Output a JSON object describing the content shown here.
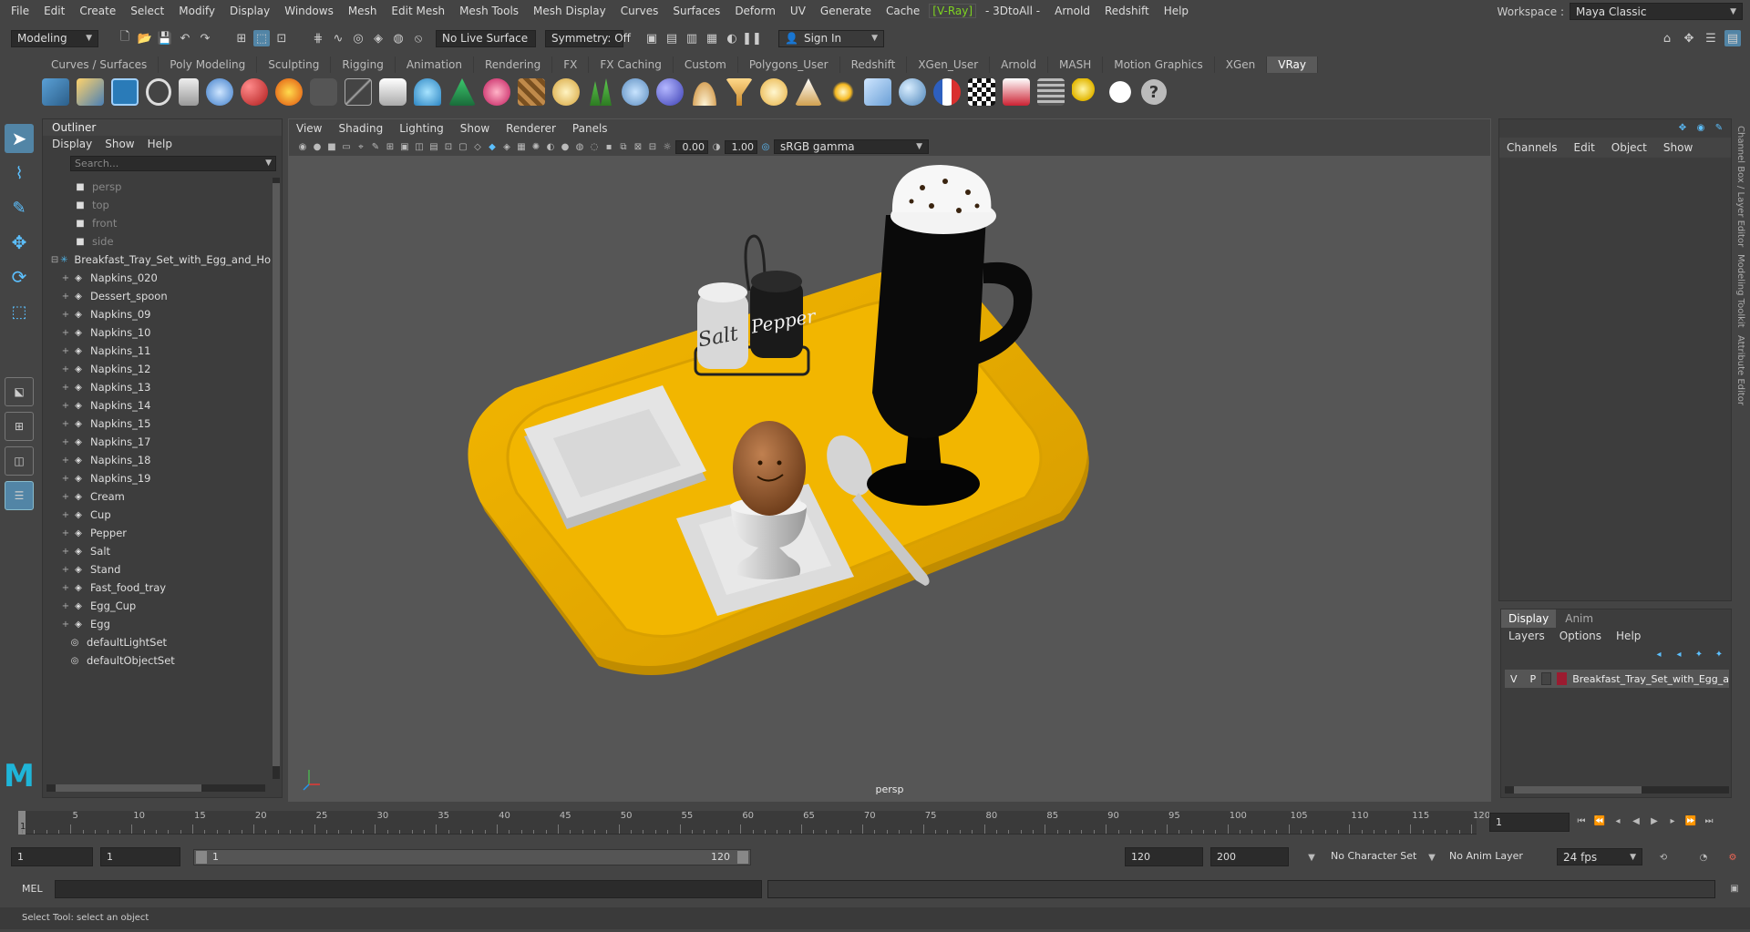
{
  "menus": [
    "File",
    "Edit",
    "Create",
    "Select",
    "Modify",
    "Display",
    "Windows",
    "Mesh",
    "Edit Mesh",
    "Mesh Tools",
    "Mesh Display",
    "Curves",
    "Surfaces",
    "Deform",
    "UV",
    "Generate",
    "Cache",
    "[V-Ray]",
    "- 3DtoAll -",
    "Arnold",
    "Redshift",
    "Help"
  ],
  "workspace": {
    "label": "Workspace :",
    "value": "Maya Classic"
  },
  "status": {
    "mode": "Modeling",
    "live_surface": "No Live Surface",
    "symmetry": "Symmetry: Off",
    "sign_in": "Sign In"
  },
  "shelf_tabs": [
    "Curves / Surfaces",
    "Poly Modeling",
    "Sculpting",
    "Rigging",
    "Animation",
    "Rendering",
    "FX",
    "FX Caching",
    "Custom",
    "Polygons_User",
    "Redshift",
    "XGen_User",
    "Arnold",
    "MASH",
    "Motion Graphics",
    "XGen",
    "VRay"
  ],
  "shelf_active": "VRay",
  "outliner": {
    "title": "Outliner",
    "menu": [
      "Display",
      "Show",
      "Help"
    ],
    "search_placeholder": "Search...",
    "cameras": [
      "persp",
      "top",
      "front",
      "side"
    ],
    "group": "Breakfast_Tray_Set_with_Egg_and_Ho",
    "children": [
      "Napkins_020",
      "Dessert_spoon",
      "Napkins_09",
      "Napkins_10",
      "Napkins_11",
      "Napkins_12",
      "Napkins_13",
      "Napkins_14",
      "Napkins_15",
      "Napkins_17",
      "Napkins_18",
      "Napkins_19",
      "Cream",
      "Cup",
      "Pepper",
      "Salt",
      "Stand",
      "Fast_food_tray",
      "Egg_Cup",
      "Egg"
    ],
    "sets": [
      "defaultLightSet",
      "defaultObjectSet"
    ]
  },
  "viewport": {
    "menu": [
      "View",
      "Shading",
      "Lighting",
      "Show",
      "Renderer",
      "Panels"
    ],
    "exposure": "0.00",
    "gamma": "1.00",
    "colorspace": "sRGB gamma",
    "camera_label": "persp",
    "salt_label": "Salt",
    "pepper_label": "Pepper"
  },
  "channel_box": {
    "menu": [
      "Channels",
      "Edit",
      "Object",
      "Show"
    ]
  },
  "layer_editor": {
    "tabs": [
      "Display",
      "Anim"
    ],
    "menu": [
      "Layers",
      "Options",
      "Help"
    ],
    "layer_name": "Breakfast_Tray_Set_with_Egg_a",
    "v": "V",
    "p": "P",
    "color": "#9b1b30"
  },
  "side_tabs": [
    "Channel Box / Layer Editor",
    "Modeling Toolkit",
    "Attribute Editor"
  ],
  "timeline": {
    "ticks": [
      "5",
      "10",
      "15",
      "20",
      "25",
      "30",
      "35",
      "40",
      "45",
      "50",
      "55",
      "60",
      "65",
      "70",
      "75",
      "80",
      "85",
      "90",
      "95",
      "100",
      "105",
      "110",
      "115",
      "120"
    ],
    "current_frame": "1",
    "start_label": "1"
  },
  "range": {
    "start": "1",
    "start_inner": "1",
    "slider_start": "1",
    "slider_end": "120",
    "end_inner": "120",
    "end": "200",
    "character_set": "No Character Set",
    "anim_layer": "No Anim Layer",
    "fps": "24 fps"
  },
  "command": {
    "label": "MEL"
  },
  "help_line": "Select Tool: select an object"
}
